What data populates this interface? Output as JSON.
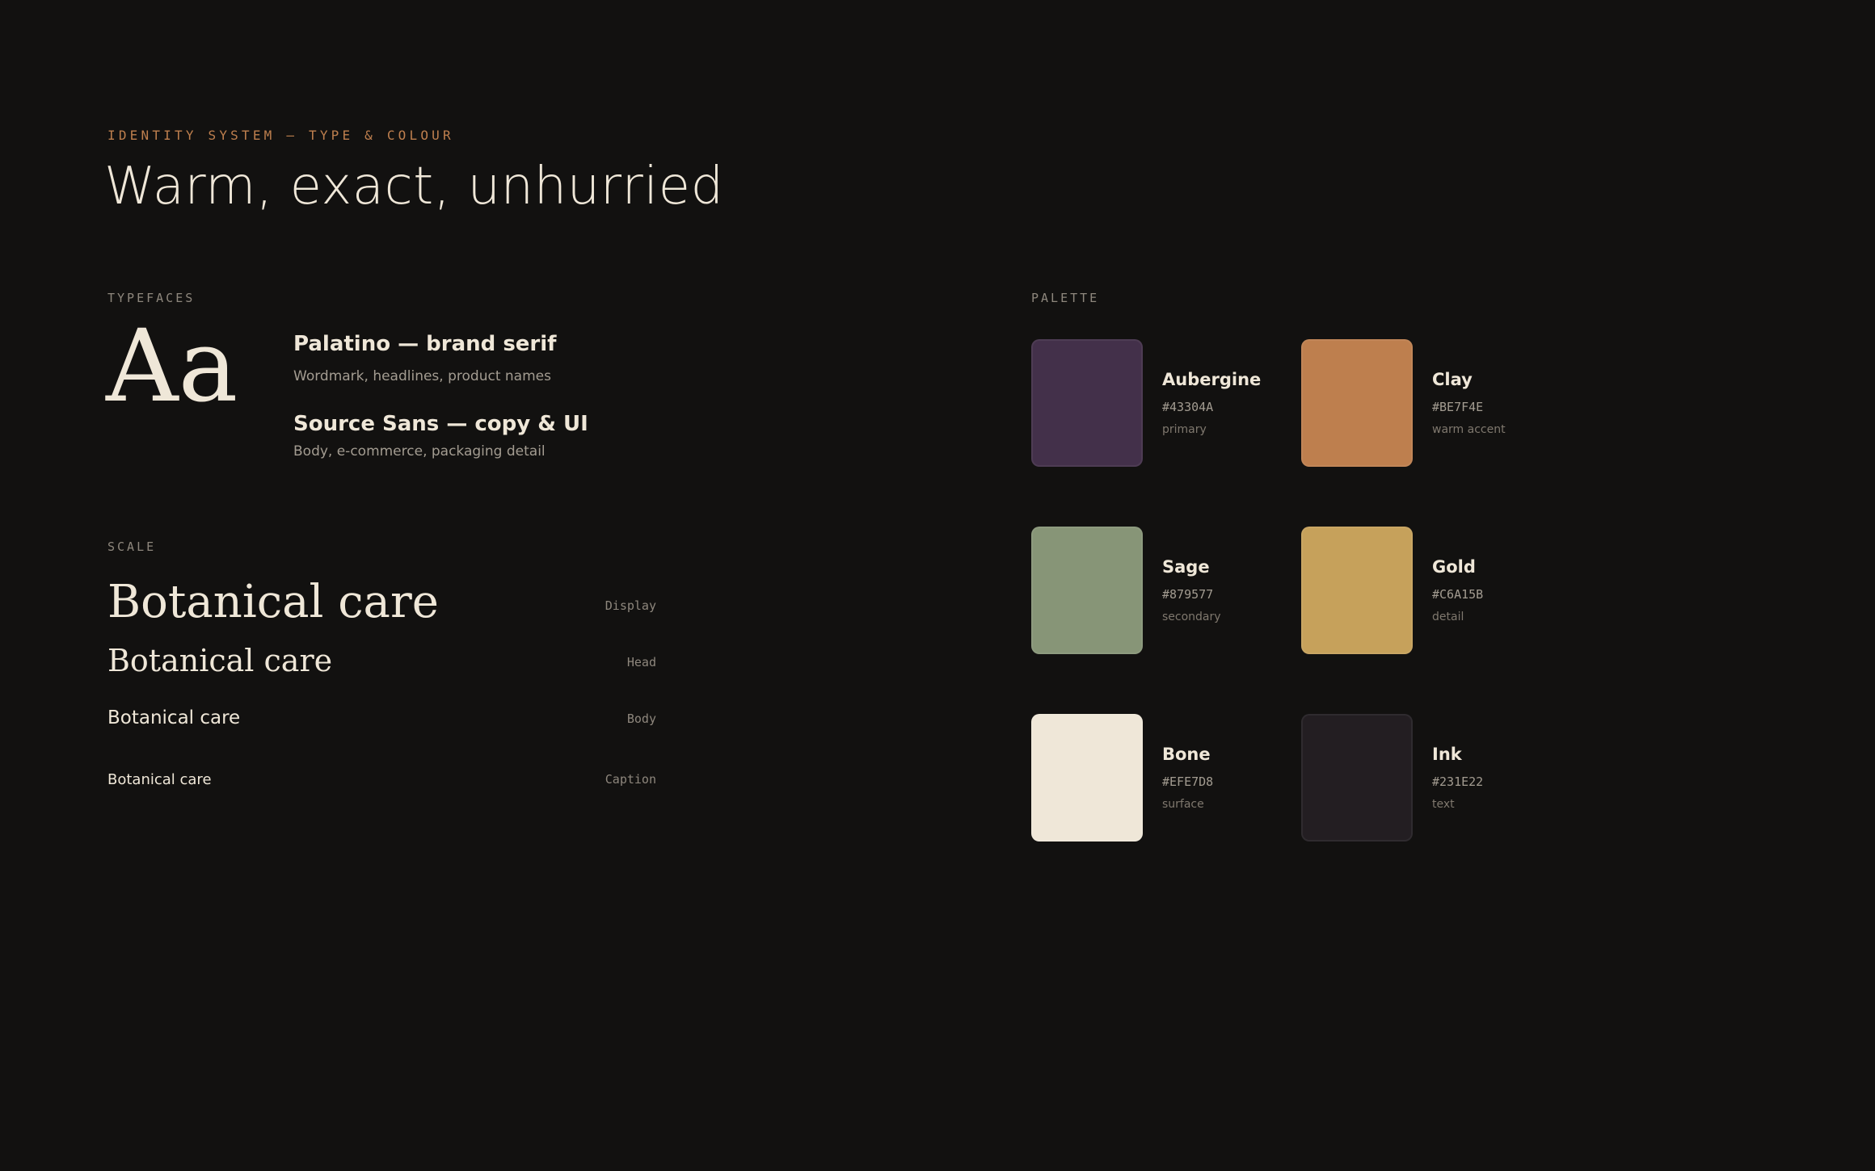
{
  "header": {
    "eyebrow": "IDENTITY SYSTEM — TYPE & COLOUR",
    "title": "Warm, exact, unhurried"
  },
  "typefaces": {
    "label": "TYPEFACES",
    "specimen": "Aa",
    "items": [
      {
        "name": "Palatino — brand serif",
        "description": "Wordmark, headlines, product names"
      },
      {
        "name": "Source Sans — copy & UI",
        "description": "Body, e-commerce, packaging detail"
      }
    ]
  },
  "scale": {
    "label": "SCALE",
    "rows": [
      {
        "sample": "Botanical care",
        "tag": "Display"
      },
      {
        "sample": "Botanical care",
        "tag": "Head"
      },
      {
        "sample": "Botanical care",
        "tag": "Body"
      },
      {
        "sample": "Botanical care",
        "tag": "Caption"
      }
    ]
  },
  "palette": {
    "label": "PALETTE",
    "swatches": [
      {
        "name": "Aubergine",
        "hex": "#43304A",
        "role": "primary",
        "color": "#43304A"
      },
      {
        "name": "Clay",
        "hex": "#BE7F4E",
        "role": "warm accent",
        "color": "#BE7F4E"
      },
      {
        "name": "Sage",
        "hex": "#879577",
        "role": "secondary",
        "color": "#879577"
      },
      {
        "name": "Gold",
        "hex": "#C6A15B",
        "role": "detail",
        "color": "#C6A15B"
      },
      {
        "name": "Bone",
        "hex": "#EFE7D8",
        "role": "surface",
        "color": "#EFE7D8"
      },
      {
        "name": "Ink",
        "hex": "#231E22",
        "role": "text",
        "color": "#231E22"
      }
    ]
  }
}
